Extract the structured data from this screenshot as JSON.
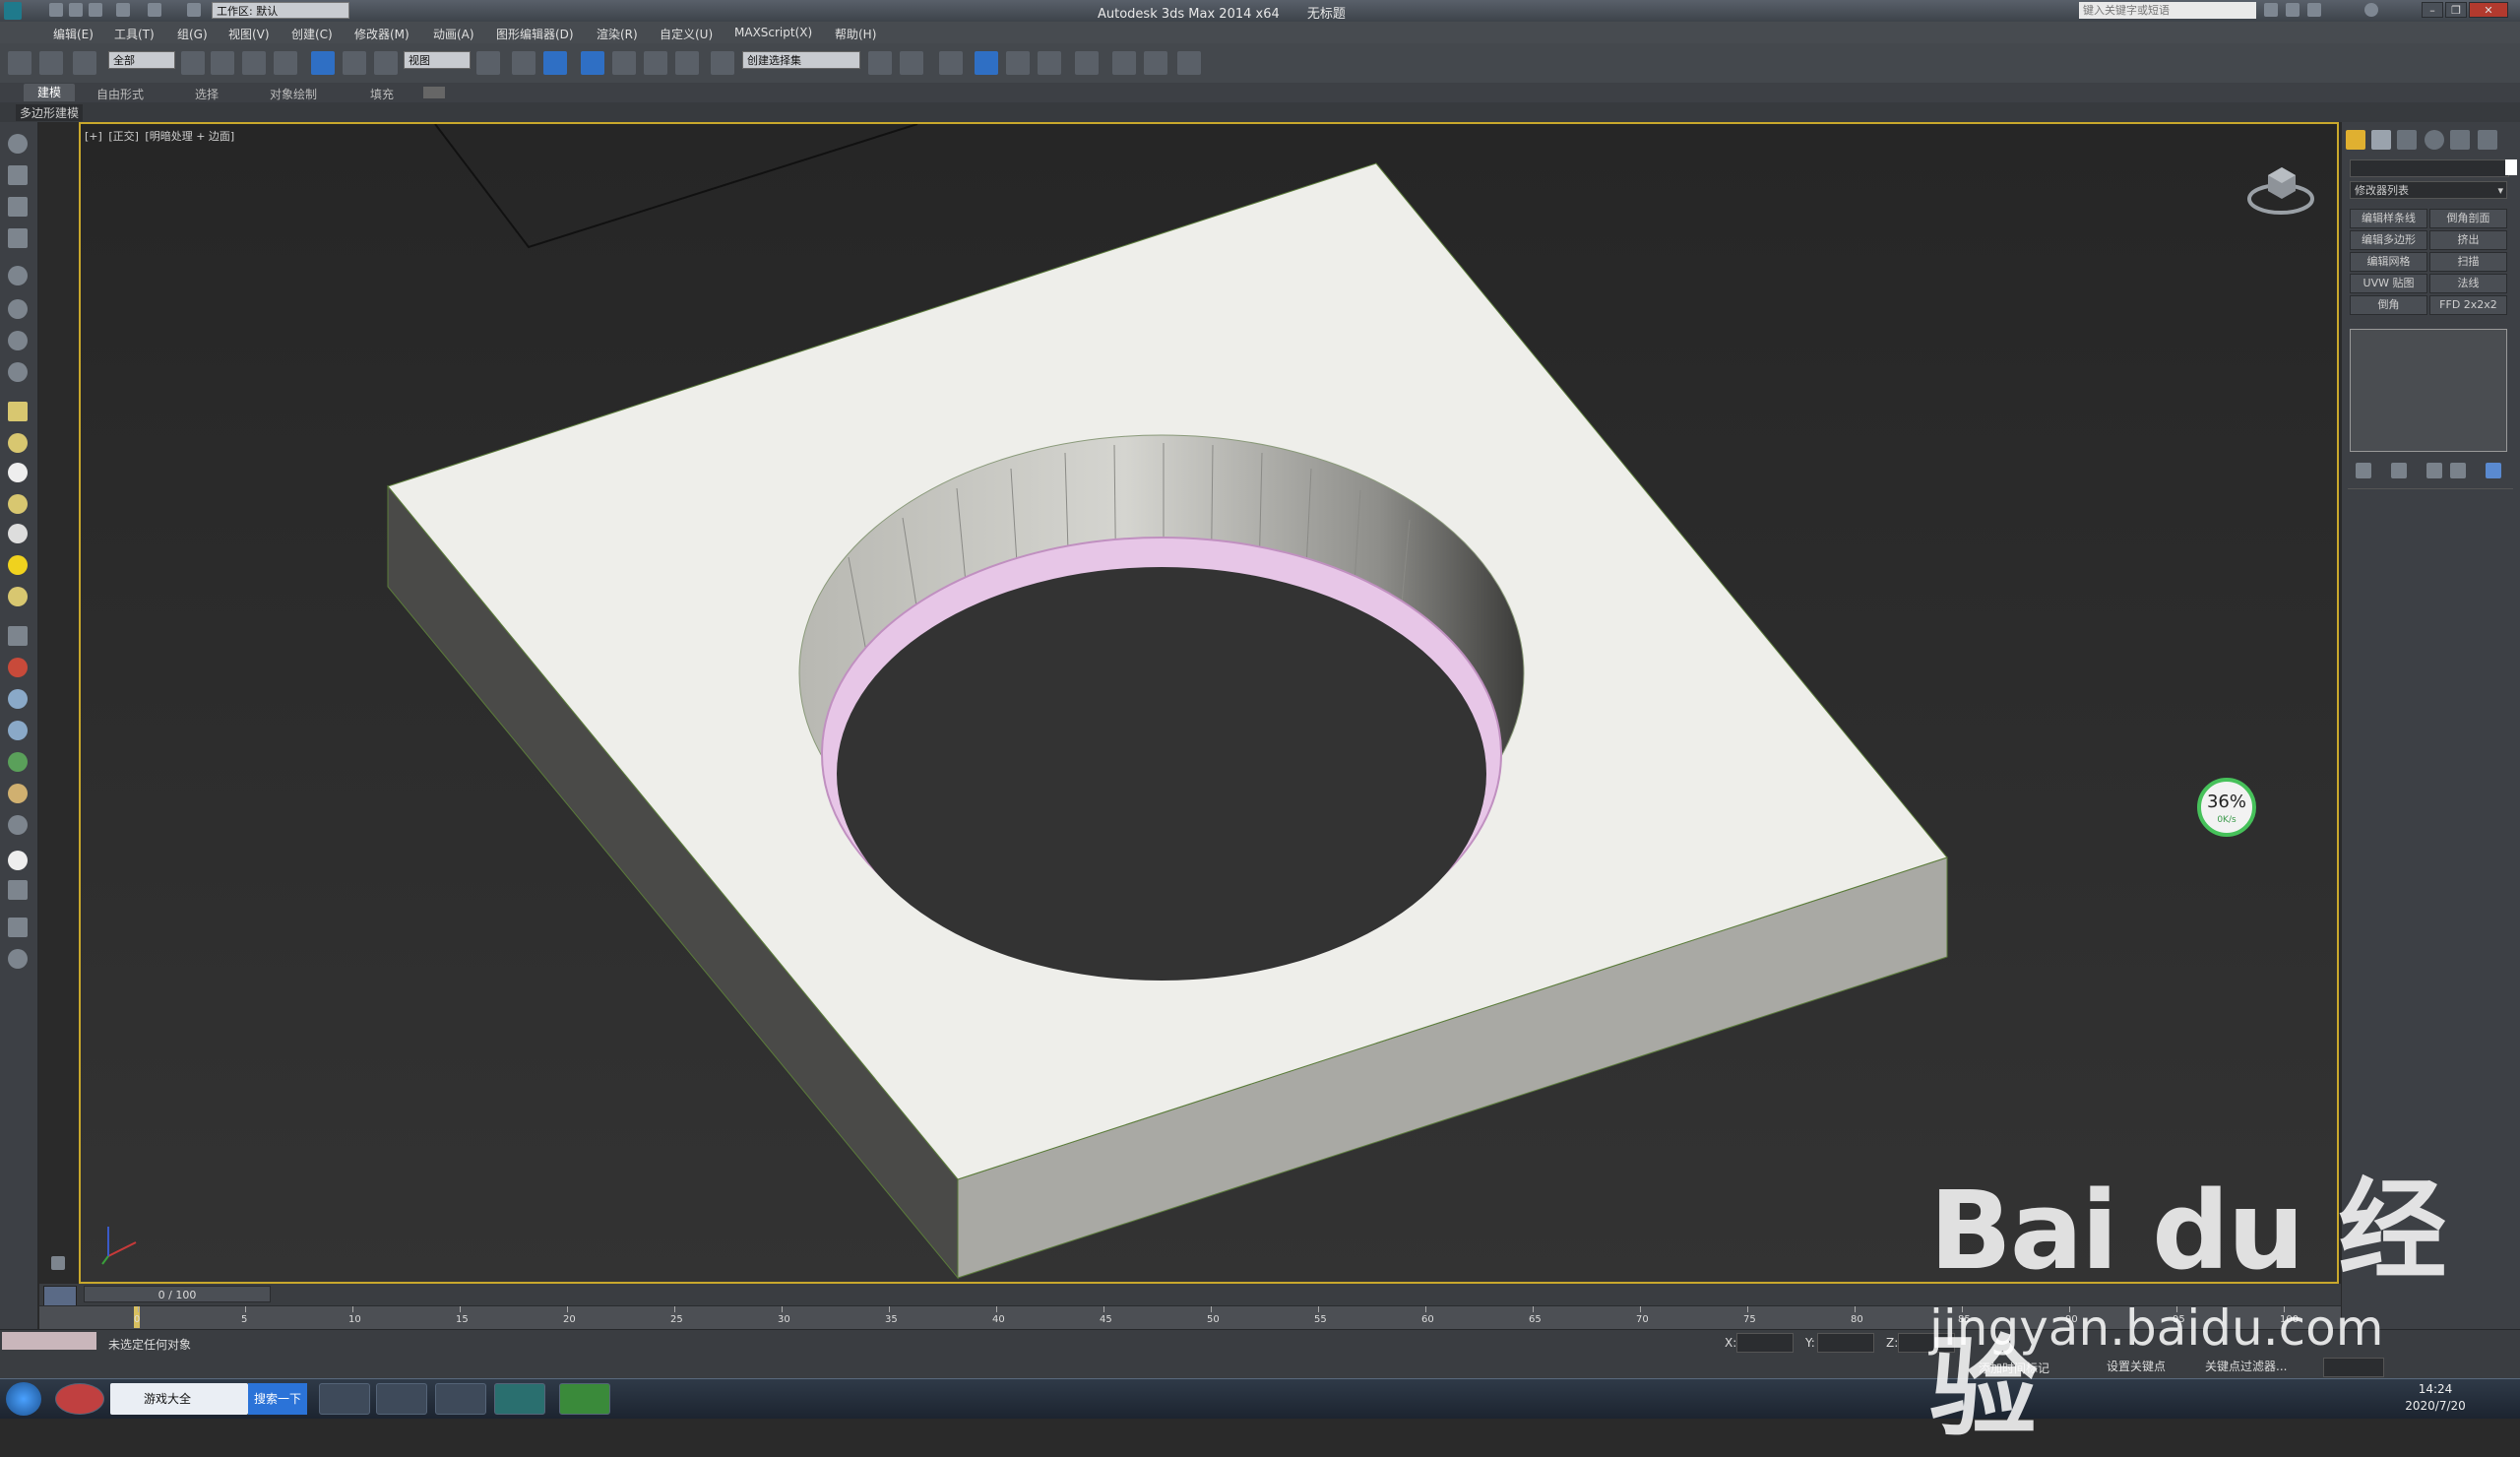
{
  "titlebar": {
    "app_title": "Autodesk 3ds Max  2014 x64",
    "doc_title": "无标题",
    "workspace": "工作区: 默认",
    "search_placeholder": "键入关键字或短语"
  },
  "menu": [
    "编辑(E)",
    "工具(T)",
    "组(G)",
    "视图(V)",
    "创建(C)",
    "修改器(M)",
    "动画(A)",
    "图形编辑器(D)",
    "渲染(R)",
    "自定义(U)",
    "MAXScript(X)",
    "帮助(H)"
  ],
  "toolbar": {
    "selection_filter": "全部",
    "ref_coord": "视图",
    "named_selection": "创建选择集"
  },
  "ribbon": {
    "tabs": [
      "建模",
      "自由形式",
      "选择",
      "对象绘制",
      "填充"
    ],
    "active_tab": "建模",
    "panel_label": "多边形建模"
  },
  "viewport": {
    "label_parts": [
      "[+]",
      "[正交]",
      "[明暗处理 + 边面]"
    ]
  },
  "command_panel": {
    "modifier_list": "修改器列表",
    "modifier_buttons": [
      [
        "编辑样条线",
        "倒角剖面"
      ],
      [
        "编辑多边形",
        "挤出"
      ],
      [
        "编辑网格",
        "扫描"
      ],
      [
        "UVW 贴图",
        "法线"
      ],
      [
        "倒角",
        "FFD 2x2x2"
      ]
    ]
  },
  "timeline": {
    "slider": "0 / 100",
    "ticks": [
      "0",
      "5",
      "10",
      "15",
      "20",
      "25",
      "30",
      "35",
      "40",
      "45",
      "50",
      "55",
      "60",
      "65",
      "70",
      "75",
      "80",
      "85",
      "90",
      "95",
      "100"
    ]
  },
  "status": {
    "message": "未选定任何对象",
    "x_label": "X:",
    "y_label": "Y:",
    "z_label": "Z:",
    "add_time_tag": "添加时间标记",
    "set_key": "设置关键点",
    "key_filters": "关键点过滤器..."
  },
  "overlay": {
    "perf_percent": "36%",
    "perf_speed": "0K/s",
    "watermark_logo": "Bai du 经验",
    "watermark_url": "jingyan.baidu.com"
  },
  "taskbar": {
    "ie_label": "游戏大全",
    "ie_search": "搜索一下",
    "time": "14:24",
    "date": "2020/7/20"
  },
  "colors": {
    "viewport_border": "#c9a82c",
    "object_top": "#eeeeea",
    "object_front": "#a9a9a4",
    "object_side": "#4a4a48",
    "hole_rim": "#e7c6e7"
  }
}
